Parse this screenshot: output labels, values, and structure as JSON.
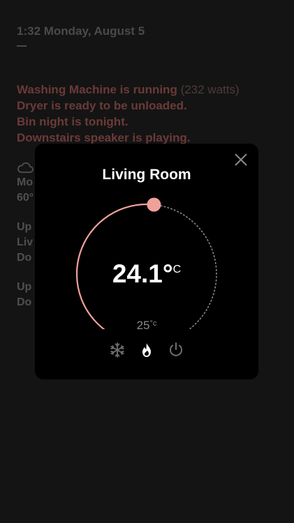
{
  "dashboard": {
    "time_line": "1:32 Monday, August 5",
    "notices": [
      {
        "text": "Washing Machine is running",
        "extra": "(232 watts)"
      },
      {
        "text": "Dryer is ready to be unloaded.",
        "extra": ""
      },
      {
        "text": "Bin night is tonight.",
        "extra": ""
      },
      {
        "text": "Downstairs speaker is playing.",
        "extra": ""
      }
    ],
    "weather": {
      "icon": "cloud-icon",
      "line1": "Mo",
      "line2": "60°"
    },
    "block1": [
      "Up",
      "Liv",
      "Do"
    ],
    "block2": [
      "Up",
      "Do"
    ]
  },
  "thermostat": {
    "room_name": "Living Room",
    "current_temp": "24.1",
    "degree_symbol": "°",
    "unit": "C",
    "target_temp": "25",
    "target_unit": "°c",
    "setpoint_fraction": 0.52,
    "accent_color": "#f0a29a",
    "modes": [
      {
        "name": "snowflake-icon",
        "active": false
      },
      {
        "name": "flame-icon",
        "active": true
      },
      {
        "name": "power-icon",
        "active": false
      }
    ]
  }
}
